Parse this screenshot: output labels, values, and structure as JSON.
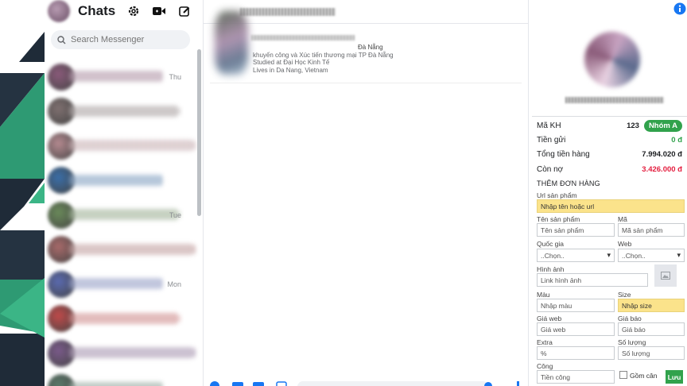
{
  "chat_list": {
    "title": "Chats",
    "search_placeholder": "Search Messenger",
    "conversations": [
      {
        "time": "Thu",
        "color": "#8a5a7a"
      },
      {
        "time": "",
        "color": "#7f7070"
      },
      {
        "time": "",
        "color": "#b58a90"
      },
      {
        "time": "",
        "color": "#3a6ea8"
      },
      {
        "time": "Tue",
        "color": "#6a8a5a"
      },
      {
        "time": "",
        "color": "#a86a6a"
      },
      {
        "time": "Mon",
        "color": "#5a6ab0"
      },
      {
        "time": "",
        "color": "#c04a4a"
      },
      {
        "time": "",
        "color": "#7a5a8a"
      },
      {
        "time": "",
        "color": "#5a7a6a"
      }
    ]
  },
  "conversation": {
    "info_line1": "Đà Nẵng",
    "info_line2": "khuyến công và Xúc tiến thương mại TP Đà Nẵng",
    "info_line3": "Studied at Đại Học Kinh Tế",
    "info_line4": "Lives in Da Nang, Vietnam"
  },
  "panel": {
    "customer_id_label": "Mã KH",
    "customer_id": "123",
    "group_badge": "Nhóm A",
    "deposit_label": "Tiền gửi",
    "deposit_value": "0 đ",
    "total_label": "Tổng tiền hàng",
    "total_value": "7.994.020 đ",
    "debt_label": "Còn nợ",
    "debt_value": "3.426.000 đ",
    "section_title": "THÊM ĐƠN HÀNG",
    "url_label": "Url sản phẩm",
    "url_placeholder": "Nhập tên hoặc url",
    "name_label": "Tên sản phẩm",
    "name_placeholder": "Tên sản phẩm",
    "code_label": "Mã",
    "code_placeholder": "Mã sản phẩm",
    "country_label": "Quốc gia",
    "country_value": "..Chọn..",
    "web_label": "Web",
    "web_value": "..Chọn..",
    "image_label": "Hình ảnh",
    "image_placeholder": "Link hình ảnh",
    "color_label": "Màu",
    "color_placeholder": "Nhập màu",
    "size_label": "Size",
    "size_placeholder": "Nhập size",
    "webprice_label": "Giá web",
    "webprice_placeholder": "Giá web",
    "quote_label": "Giá báo",
    "quote_placeholder": "Giá báo",
    "extra_label": "Extra",
    "extra_placeholder": "%",
    "qty_label": "Số lượng",
    "qty_placeholder": "Số lượng",
    "labor_label": "Công",
    "labor_placeholder": "Tiền công",
    "include_label": "Gồm cân",
    "save_label": "Lưu",
    "colors": {
      "accent_green": "#31a24c",
      "debt_red": "#e41e3f",
      "deposit_green": "#31a24c",
      "highlight_yellow": "#fbe38b"
    }
  }
}
